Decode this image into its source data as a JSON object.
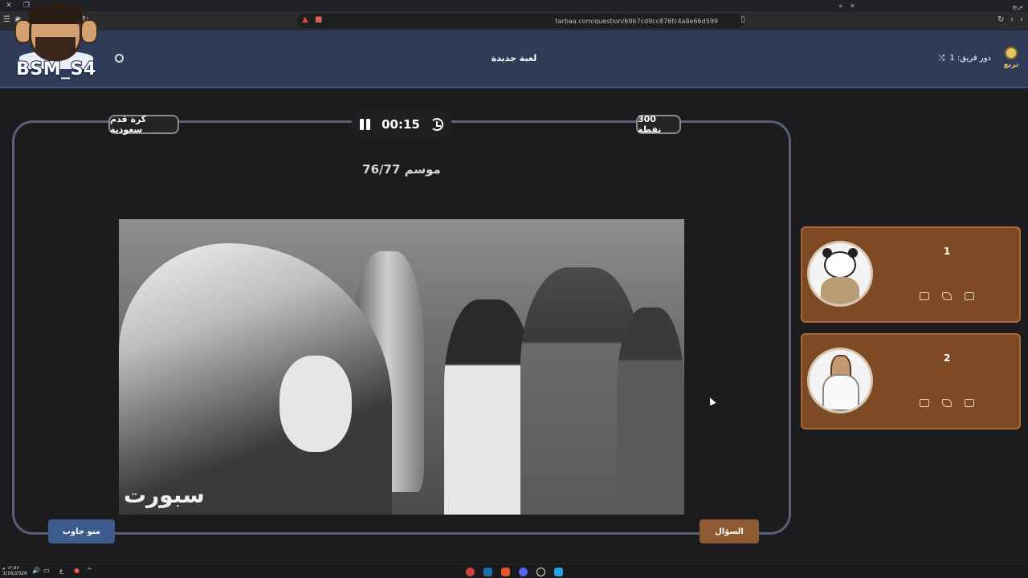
{
  "browser": {
    "url": "tarbaa.com/question/69b7cd9cc876fc4a8e66d599",
    "tab_title": "تربع"
  },
  "header": {
    "game_title": "لعبة جديدة",
    "team_turn": "دور فريق: 1",
    "site_name": "تربع"
  },
  "streamer": {
    "name": "BSM_S4"
  },
  "question": {
    "category": "كرة قدم سعودية",
    "points": "300 نقطة",
    "timer": "00:15",
    "text": "موسم 76/77",
    "image_watermark": "سبورت"
  },
  "buttons": {
    "who_answered": "منو جاوب",
    "question": "السؤال"
  },
  "teams": [
    {
      "score": "1",
      "avatar_icon": "panda-icon"
    },
    {
      "score": "2",
      "avatar_icon": "horse-icon"
    }
  ],
  "taskbar": {
    "time": "١٢:٥٧ م",
    "date": "3/16/2026",
    "lang": "ع"
  },
  "colors": {
    "header_bg": "#2f3b57",
    "team_card": "#7d4a24",
    "answer_btn": "#3e5b8e",
    "question_btn": "#8d5a31"
  }
}
